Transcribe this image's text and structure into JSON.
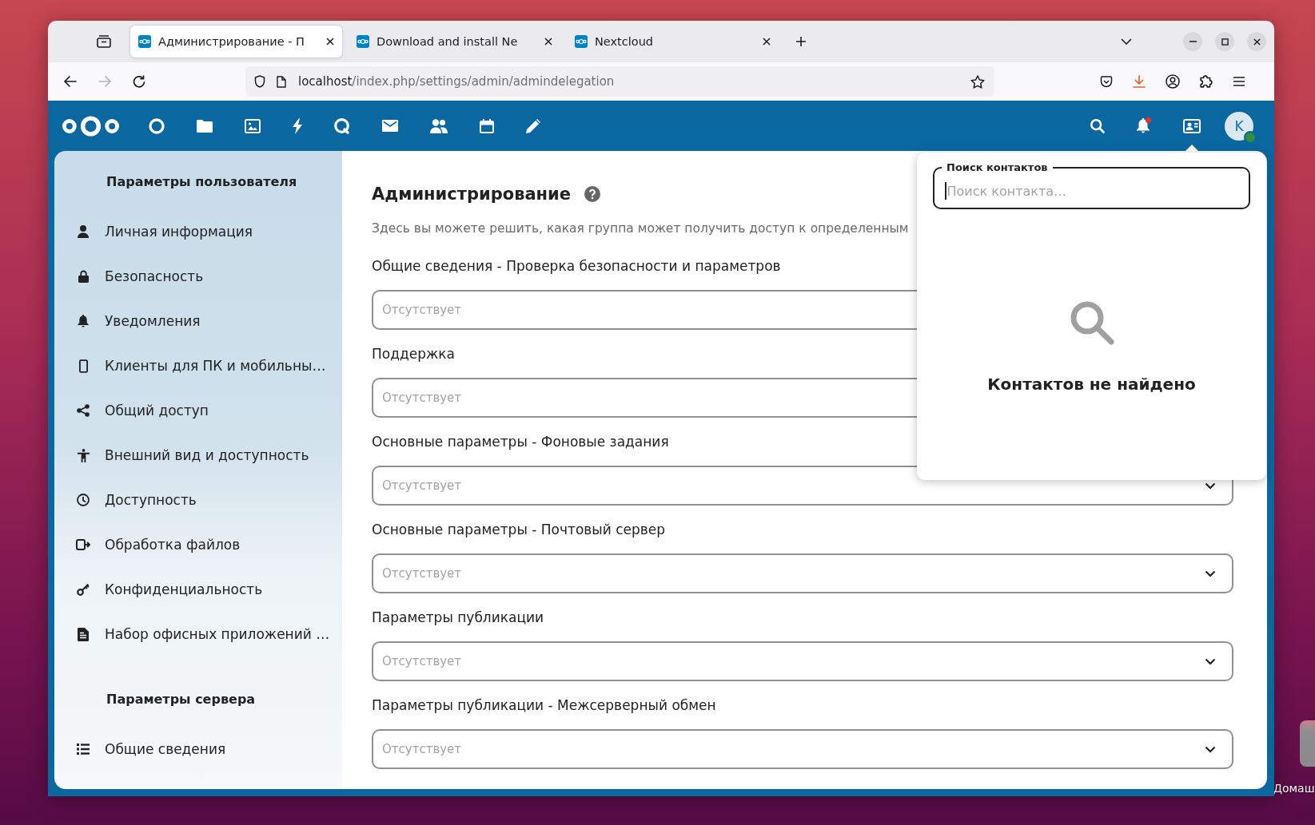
{
  "browser": {
    "tabs": [
      {
        "title": "Администрирование - П",
        "selected": true
      },
      {
        "title": "Download and install Ne",
        "selected": false
      },
      {
        "title": "Nextcloud",
        "selected": false
      }
    ],
    "forward_enabled": false,
    "url": {
      "host": "localhost",
      "path": "/index.php/settings/admin/admindelegation"
    },
    "download_attention": true
  },
  "header": {
    "notifications_unread": true,
    "avatar": {
      "initial": "K",
      "online": true
    }
  },
  "sidebar": {
    "sections": [
      {
        "heading": "Параметры пользователя",
        "items": [
          {
            "label": "Личная информация",
            "selected": false
          },
          {
            "label": "Безопасность",
            "selected": false
          },
          {
            "label": "Уведомления",
            "selected": false
          },
          {
            "label": "Клиенты для ПК и мобильны…",
            "selected": false
          },
          {
            "label": "Общий доступ",
            "selected": false
          },
          {
            "label": "Внешний вид и доступность",
            "selected": false
          },
          {
            "label": "Доступность",
            "selected": false
          },
          {
            "label": "Обработка файлов",
            "selected": false
          },
          {
            "label": "Конфиденциальность",
            "selected": false
          },
          {
            "label": "Набор офисных приложений …",
            "selected": false
          }
        ]
      },
      {
        "heading": "Параметры сервера",
        "items": [
          {
            "label": "Общие сведения",
            "selected": false
          }
        ]
      }
    ]
  },
  "main": {
    "title": "Администрирование",
    "description": "Здесь вы можете решить, какая группа может получить доступ к определенным",
    "fields": [
      {
        "label": "Общие сведения - Проверка безопасности и параметров",
        "placeholder": "Отсутствует"
      },
      {
        "label": "Поддержка",
        "placeholder": "Отсутствует"
      },
      {
        "label": "Основные параметры - Фоновые задания",
        "placeholder": "Отсутствует"
      },
      {
        "label": "Основные параметры - Почтовый сервер",
        "placeholder": "Отсутствует"
      },
      {
        "label": "Параметры публикации",
        "placeholder": "Отсутствует"
      },
      {
        "label": "Параметры публикации - Межсерверный обмен",
        "placeholder": "Отсутствует"
      }
    ]
  },
  "contacts_menu": {
    "open": true,
    "search": {
      "label": "Поиск контактов",
      "placeholder": "Поиск контакта…",
      "focused": true
    },
    "empty_text": "Контактов не найдено"
  },
  "desktop": {
    "icons": [
      {
        "label": "Домаш"
      }
    ]
  }
}
